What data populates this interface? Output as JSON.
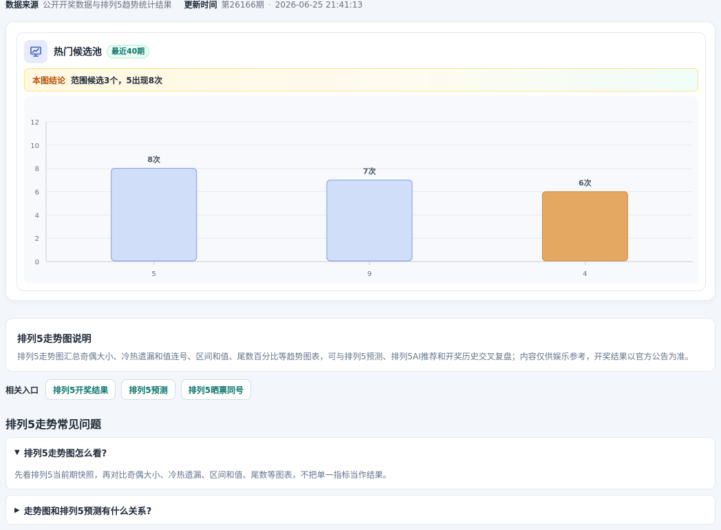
{
  "meta": {
    "source_label": "数据来源",
    "source_value": "公开开奖数据与排列5趋势统计结果",
    "update_label": "更新时间",
    "issue": "第26166期",
    "separator": "·",
    "timestamp": "2026-06-25 21:41:13"
  },
  "panel": {
    "icon": "chart-presentation-icon",
    "title": "热门候选池",
    "badge": "最近40期",
    "conclusion_label": "本图结论",
    "conclusion_text": "范围候选3个，5出现8次"
  },
  "chart_data": {
    "type": "bar",
    "categories": [
      "5",
      "9",
      "4"
    ],
    "values": [
      8,
      7,
      6
    ],
    "data_labels": [
      "8次",
      "7次",
      "6次"
    ],
    "yticks": [
      "0",
      "2",
      "4",
      "6",
      "8",
      "10",
      "12"
    ],
    "ylim": [
      0,
      12
    ],
    "grid": true,
    "colors": [
      "#d1defa",
      "#d1defa",
      "#e5a862"
    ],
    "stroke_colors": [
      "#7f9ee0",
      "#7f9ee0",
      "#c98a48"
    ]
  },
  "description": {
    "title": "排列5走势图说明",
    "text": "排列5走势图汇总奇偶大小、冷热遗漏和值连号、区间和值、尾数百分比等趋势图表，可与排列5预测、排列5AI推荐和开奖历史交叉复盘；内容仅供娱乐参考，开奖结果以官方公告为准。"
  },
  "related": {
    "label": "相关入口",
    "links": [
      "排列5开奖结果",
      "排列5预测",
      "排列5晒票同号"
    ]
  },
  "faq": {
    "heading": "排列5走势常见问题",
    "items": [
      {
        "expanded_marker": "▼",
        "question": "排列5走势图怎么看?",
        "answer": "先看排列5当前期快照，再对比奇偶大小、冷热遗漏、区间和值、尾数等图表，不把单一指标当作结果。"
      },
      {
        "collapsed_marker": "▶",
        "question": "走势图和排列5预测有什么关系?"
      }
    ]
  }
}
